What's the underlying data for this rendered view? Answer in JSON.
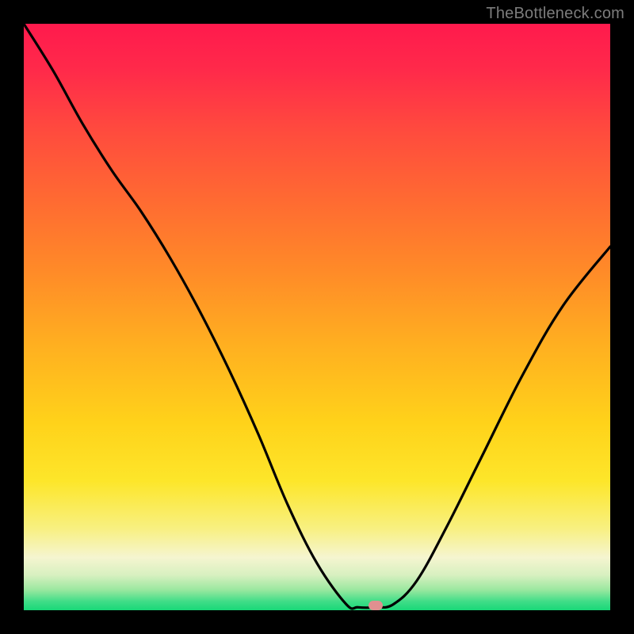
{
  "watermark": {
    "text": "TheBottleneck.com"
  },
  "marker": {
    "color": "#e09090",
    "x_pct": 60,
    "y_pct": 99.2
  },
  "gradient_stops": [
    {
      "offset": 0,
      "color": "#ff1a4d"
    },
    {
      "offset": 0.08,
      "color": "#ff2a4a"
    },
    {
      "offset": 0.18,
      "color": "#ff4a3e"
    },
    {
      "offset": 0.3,
      "color": "#ff6a32"
    },
    {
      "offset": 0.42,
      "color": "#ff8a28"
    },
    {
      "offset": 0.55,
      "color": "#ffb020"
    },
    {
      "offset": 0.68,
      "color": "#ffd21a"
    },
    {
      "offset": 0.78,
      "color": "#fde62a"
    },
    {
      "offset": 0.86,
      "color": "#f8f080"
    },
    {
      "offset": 0.91,
      "color": "#f5f5d0"
    },
    {
      "offset": 0.94,
      "color": "#d8f0c0"
    },
    {
      "offset": 0.965,
      "color": "#9be8a0"
    },
    {
      "offset": 0.985,
      "color": "#40dd88"
    },
    {
      "offset": 1.0,
      "color": "#18d878"
    }
  ],
  "chart_data": {
    "type": "line",
    "title": "",
    "xlabel": "",
    "ylabel": "",
    "xlim": [
      0,
      100
    ],
    "ylim": [
      0,
      100
    ],
    "y_axis_inverted_meaning": "lower y = better (green), higher y = worse (red)",
    "series": [
      {
        "name": "bottleneck-curve",
        "x": [
          0,
          5,
          10,
          15,
          20,
          25,
          30,
          35,
          40,
          45,
          50,
          55,
          57,
          60,
          63,
          67,
          72,
          78,
          85,
          92,
          100
        ],
        "y": [
          100,
          92,
          83,
          75,
          68,
          60,
          51,
          41,
          30,
          18,
          8,
          1,
          0.5,
          0.5,
          1,
          5,
          14,
          26,
          40,
          52,
          62
        ]
      }
    ],
    "optimal_point": {
      "x": 60,
      "y": 0.5
    },
    "annotations": [
      {
        "text": "TheBottleneck.com",
        "role": "watermark",
        "position": "top-right"
      }
    ]
  }
}
